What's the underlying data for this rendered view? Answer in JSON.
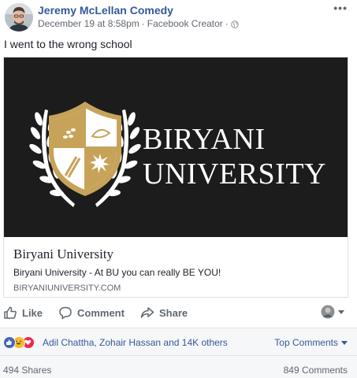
{
  "post": {
    "author": "Jeremy McLellan Comedy",
    "date": "December 19 at 8:58pm",
    "separator": "·",
    "role": "Facebook Creator",
    "more_glyph": "•••",
    "text": "I went to the wrong school"
  },
  "link_card": {
    "image_brand_line1": "BIRYANI",
    "image_brand_line2": "UNIVERSITY",
    "title": "Biryani University",
    "description": "Biryani University - At BU you can really BE YOU!",
    "domain": "BIRYANIUNIVERSITY.COM"
  },
  "actions": {
    "like": "Like",
    "comment": "Comment",
    "share": "Share"
  },
  "footer": {
    "reaction_names": "Adil Chattha, Zohair Hassan and 14K others",
    "top_comments": "Top Comments",
    "shares": "494 Shares",
    "comments": "849 Comments"
  },
  "colors": {
    "link_blue": "#365899",
    "gold": "#c7a35a",
    "dark_bg": "#1c1c1c",
    "like_blue": "#4267b2",
    "love_red": "#f0284a",
    "haha_yellow": "#f7b928"
  },
  "icons": {
    "like": "thumbs-up-icon",
    "comment": "speech-bubble-icon",
    "share": "share-arrow-icon",
    "globe": "globe-icon",
    "more": "more-dots-icon",
    "dropdown": "caret-down-icon"
  }
}
